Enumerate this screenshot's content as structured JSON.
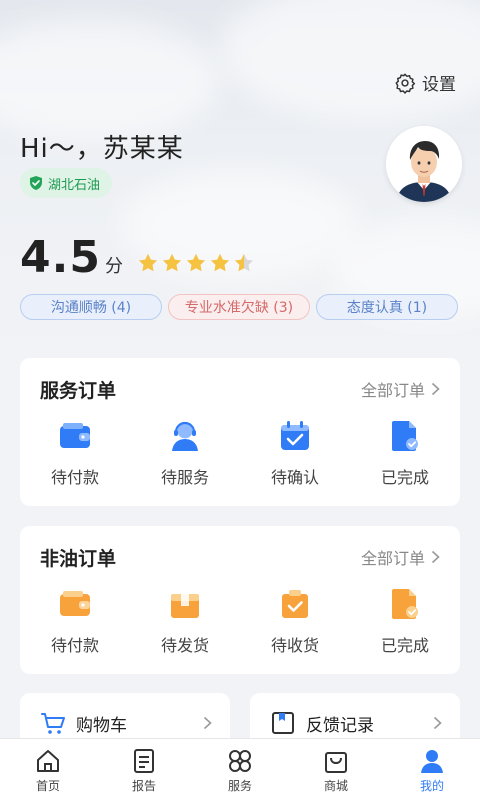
{
  "header": {
    "settings_label": "设置",
    "greeting": "Hi～，苏某某",
    "company": "湖北石油"
  },
  "rating": {
    "score": "4.5",
    "unit": "分",
    "stars": 4.5,
    "max_stars": 5
  },
  "tags": [
    {
      "label": "沟通顺畅 (4)",
      "tone": "blue"
    },
    {
      "label": "专业水准欠缺 (3)",
      "tone": "red"
    },
    {
      "label": "态度认真 (1)",
      "tone": "blue"
    }
  ],
  "service_orders": {
    "title": "服务订单",
    "all_label": "全部订单",
    "items": [
      {
        "label": "待付款",
        "icon": "wallet-icon"
      },
      {
        "label": "待服务",
        "icon": "agent-icon"
      },
      {
        "label": "待确认",
        "icon": "calendar-check-icon"
      },
      {
        "label": "已完成",
        "icon": "document-check-icon"
      }
    ]
  },
  "nonoil_orders": {
    "title": "非油订单",
    "all_label": "全部订单",
    "items": [
      {
        "label": "待付款",
        "icon": "wallet-icon"
      },
      {
        "label": "待发货",
        "icon": "box-icon"
      },
      {
        "label": "待收货",
        "icon": "package-check-icon"
      },
      {
        "label": "已完成",
        "icon": "document-check-icon"
      }
    ]
  },
  "shortcuts": {
    "cart": "购物车",
    "feedback": "反馈记录"
  },
  "tabbar": [
    {
      "label": "首页",
      "icon": "home-icon",
      "active": false
    },
    {
      "label": "报告",
      "icon": "report-icon",
      "active": false
    },
    {
      "label": "服务",
      "icon": "grid-icon",
      "active": false
    },
    {
      "label": "商城",
      "icon": "shopping-bag-icon",
      "active": false
    },
    {
      "label": "我的",
      "icon": "user-icon",
      "active": true
    }
  ],
  "colors": {
    "accent": "#2f7cf6",
    "star": "#f5c242",
    "badge_green": "#1f9a52",
    "orange": "#f7a23b"
  }
}
